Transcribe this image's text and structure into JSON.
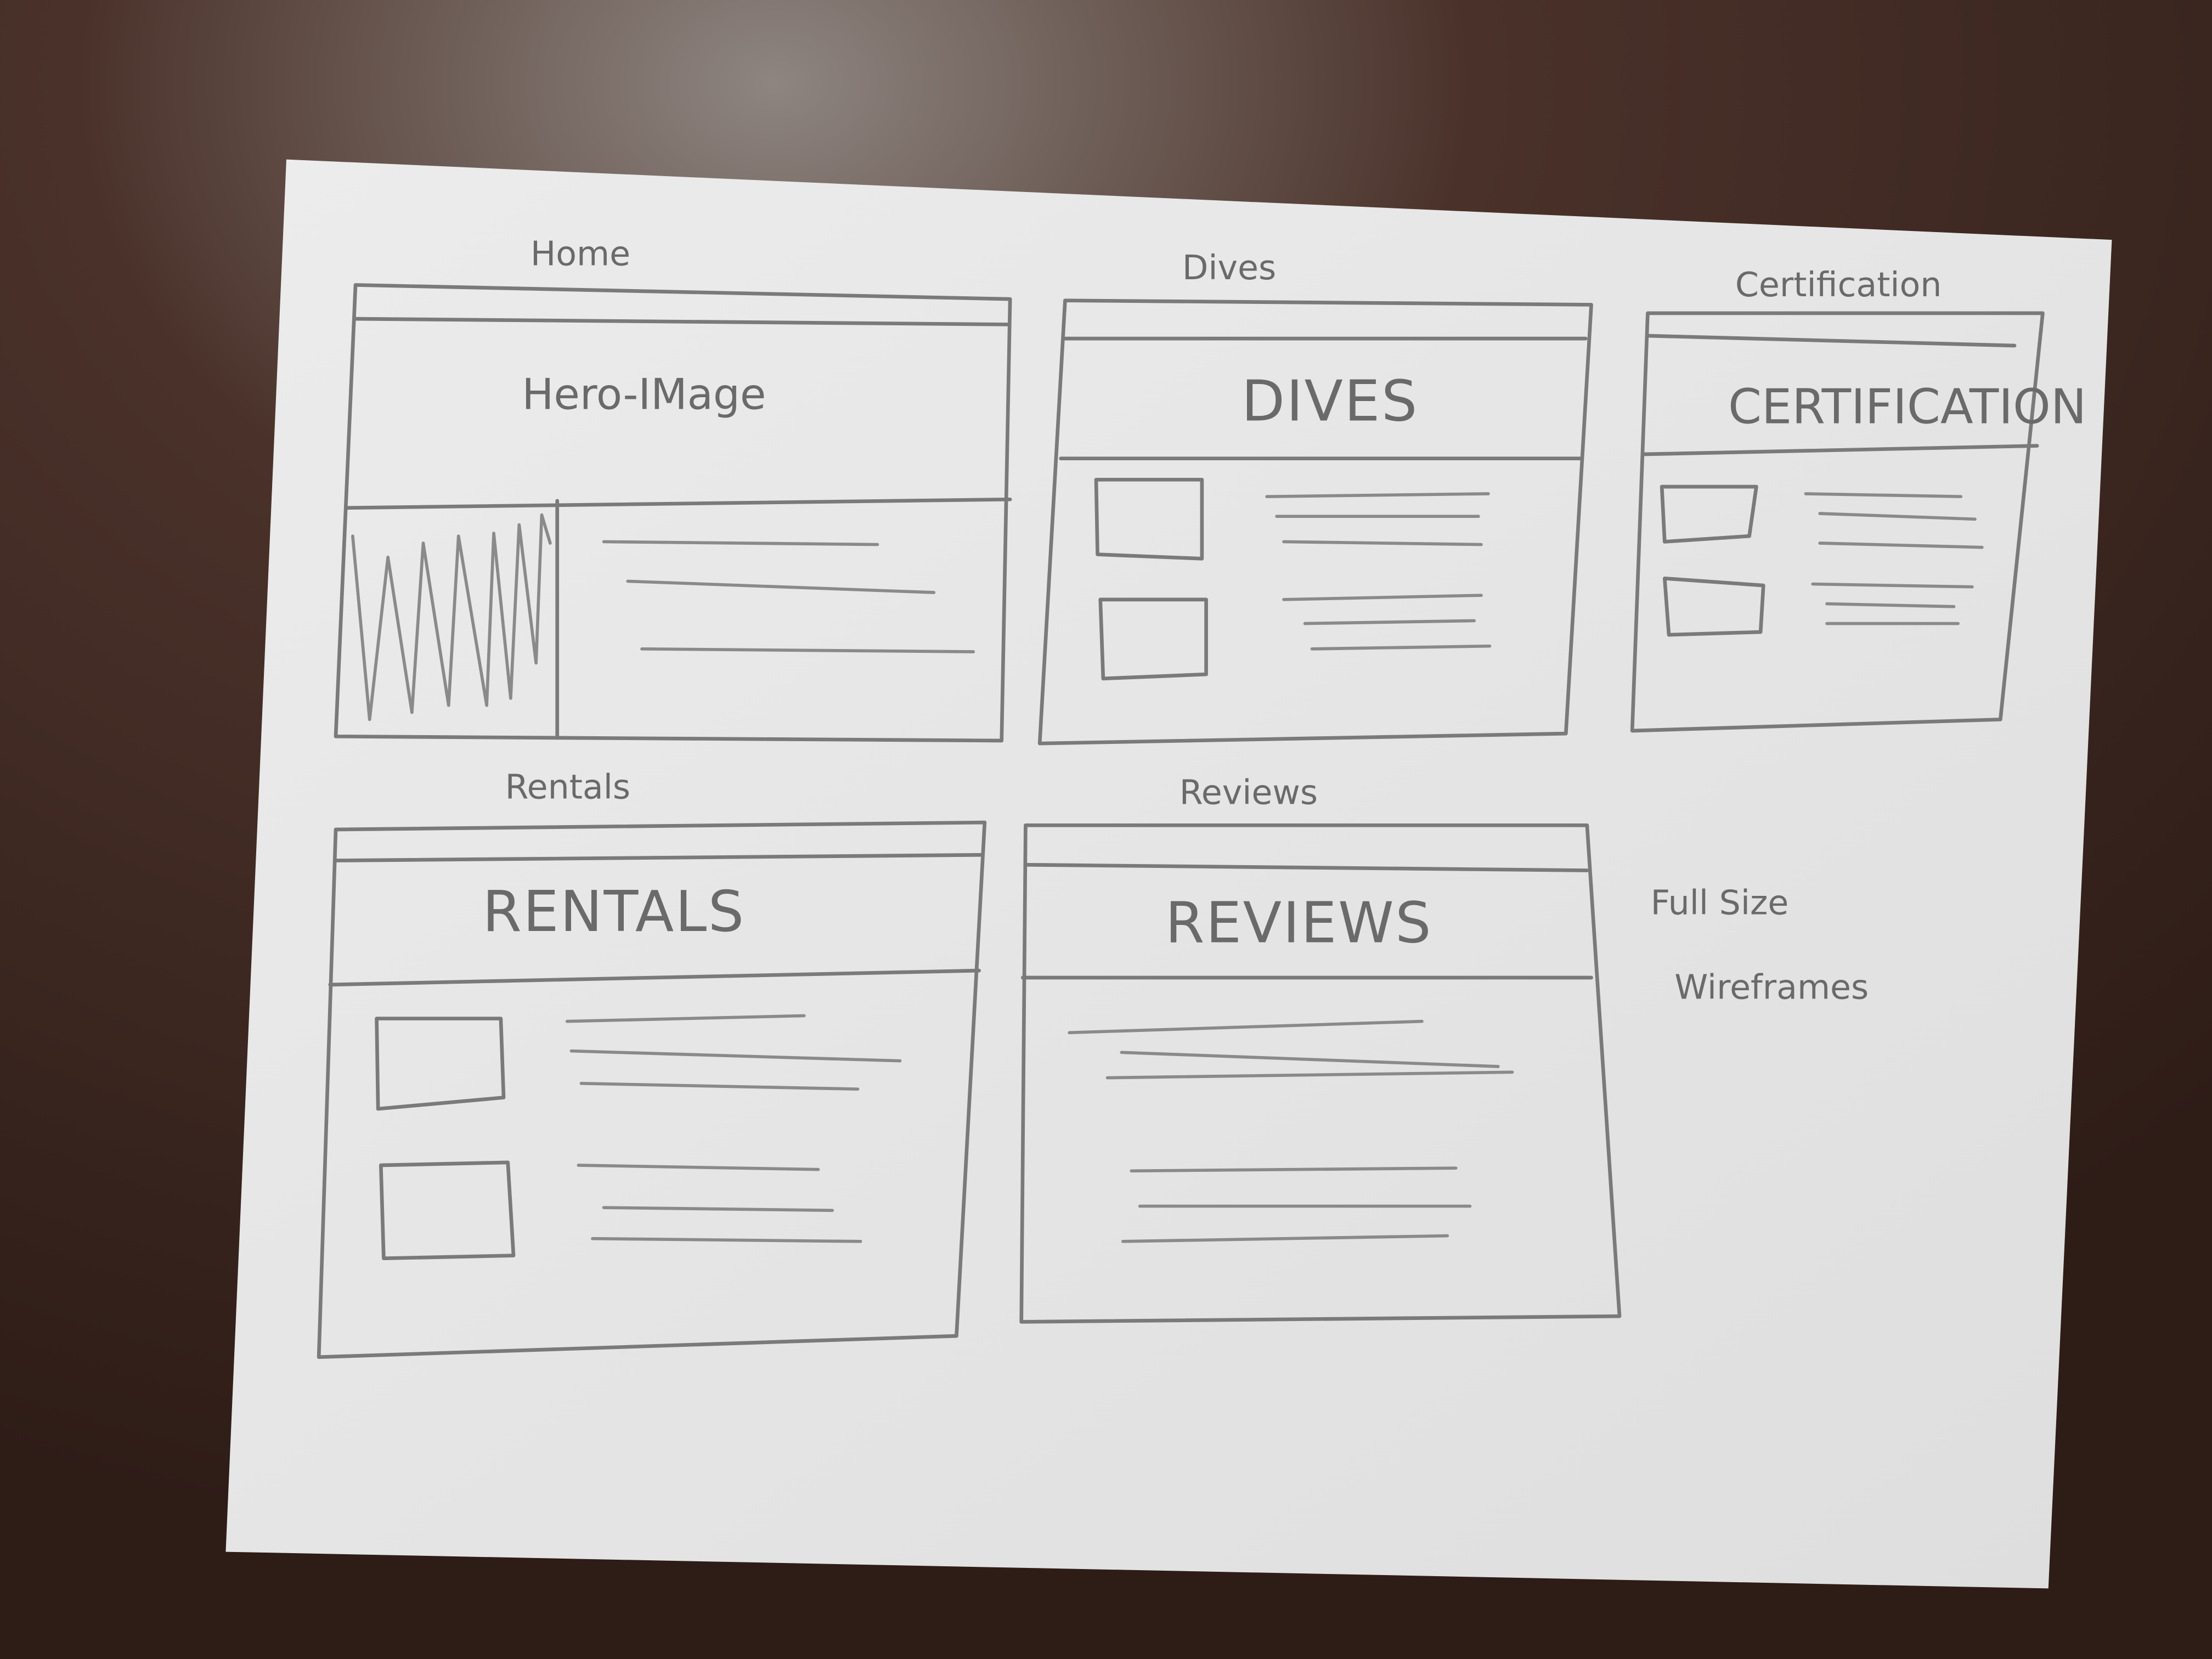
{
  "colors": {
    "desk": "#3b2721",
    "paper": "#e6e6e6",
    "pencil": "#7a7a7a"
  },
  "sheet_note": {
    "line1": "Full Size",
    "line2": "Wireframes"
  },
  "wireframes": {
    "home": {
      "label": "Home",
      "hero": "Hero-IMage"
    },
    "dives": {
      "label": "Dives",
      "heading": "DIVES"
    },
    "certification": {
      "label": "Certification",
      "heading": "CERTIFICATION"
    },
    "rentals": {
      "label": "Rentals",
      "heading": "RENTALS"
    },
    "reviews": {
      "label": "Reviews",
      "heading": "REVIEWS"
    }
  }
}
